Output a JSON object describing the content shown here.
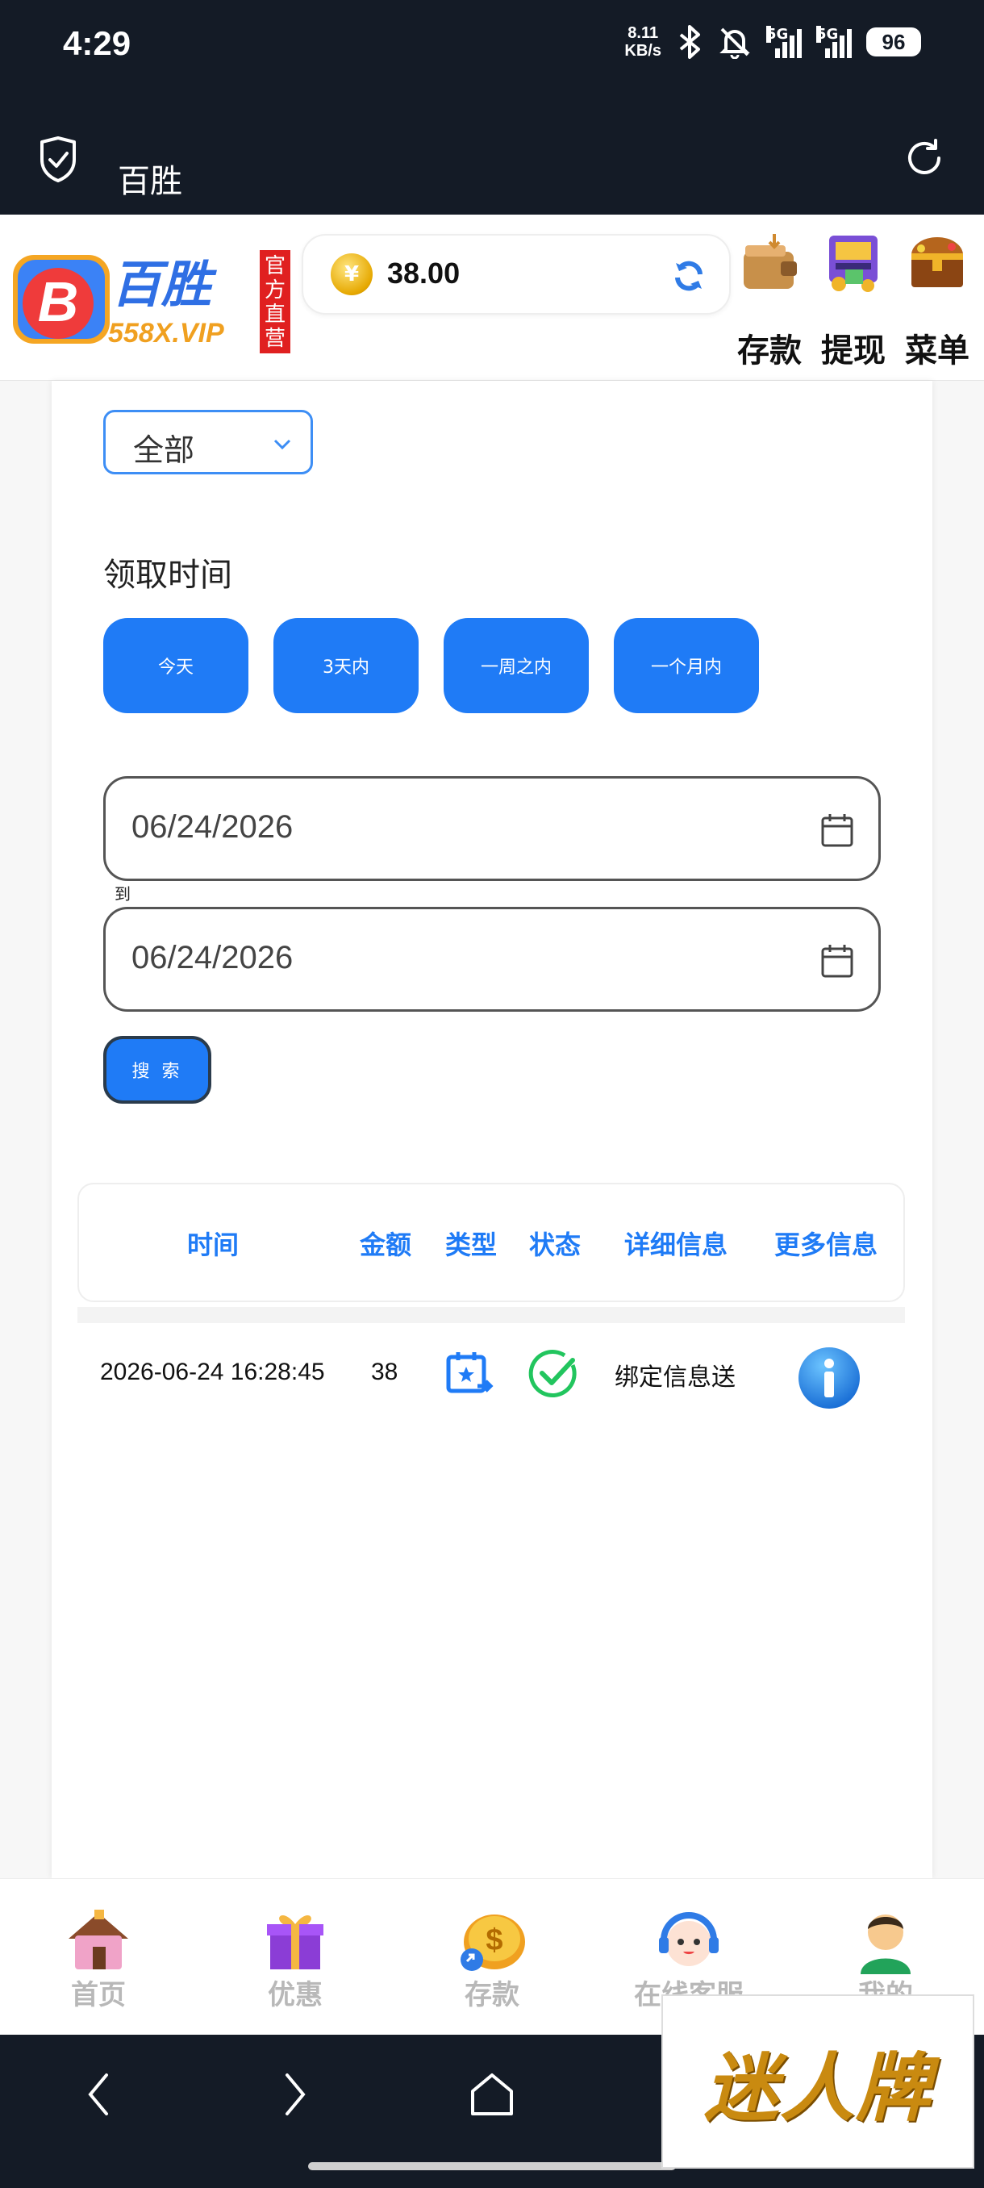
{
  "status_bar": {
    "time": "4:29",
    "net_speed_value": "8.11",
    "net_speed_unit": "KB/s",
    "network": "5G",
    "battery": "96"
  },
  "browser": {
    "title": "百胜"
  },
  "header": {
    "logo_text": "百胜",
    "logo_domain": "558X.VIP",
    "logo_badge": "官方直营",
    "balance": "38.00",
    "actions": [
      "存款",
      "提现",
      "菜单"
    ]
  },
  "filter": {
    "select_value": "全部",
    "time_label": "领取时间",
    "ranges": [
      "今天",
      "3天内",
      "一周之内",
      "一个月内"
    ],
    "start_date": "06/24/2026",
    "to_label": "到",
    "end_date": "06/24/2026",
    "search_label": "搜 索"
  },
  "table": {
    "headers": [
      "时间",
      "金额",
      "类型",
      "状态",
      "详细信息",
      "更多信息"
    ],
    "rows": [
      {
        "time": "2026-06-24 16:28:45",
        "amount": "38",
        "detail": "绑定信息送"
      }
    ]
  },
  "bottom_nav": [
    "首页",
    "优惠",
    "存款",
    "在线客服",
    "我的"
  ],
  "watermark": "迷人牌",
  "colors": {
    "accent": "#1f7bf6",
    "dark_bar": "#141b26",
    "success": "#22c55e"
  }
}
